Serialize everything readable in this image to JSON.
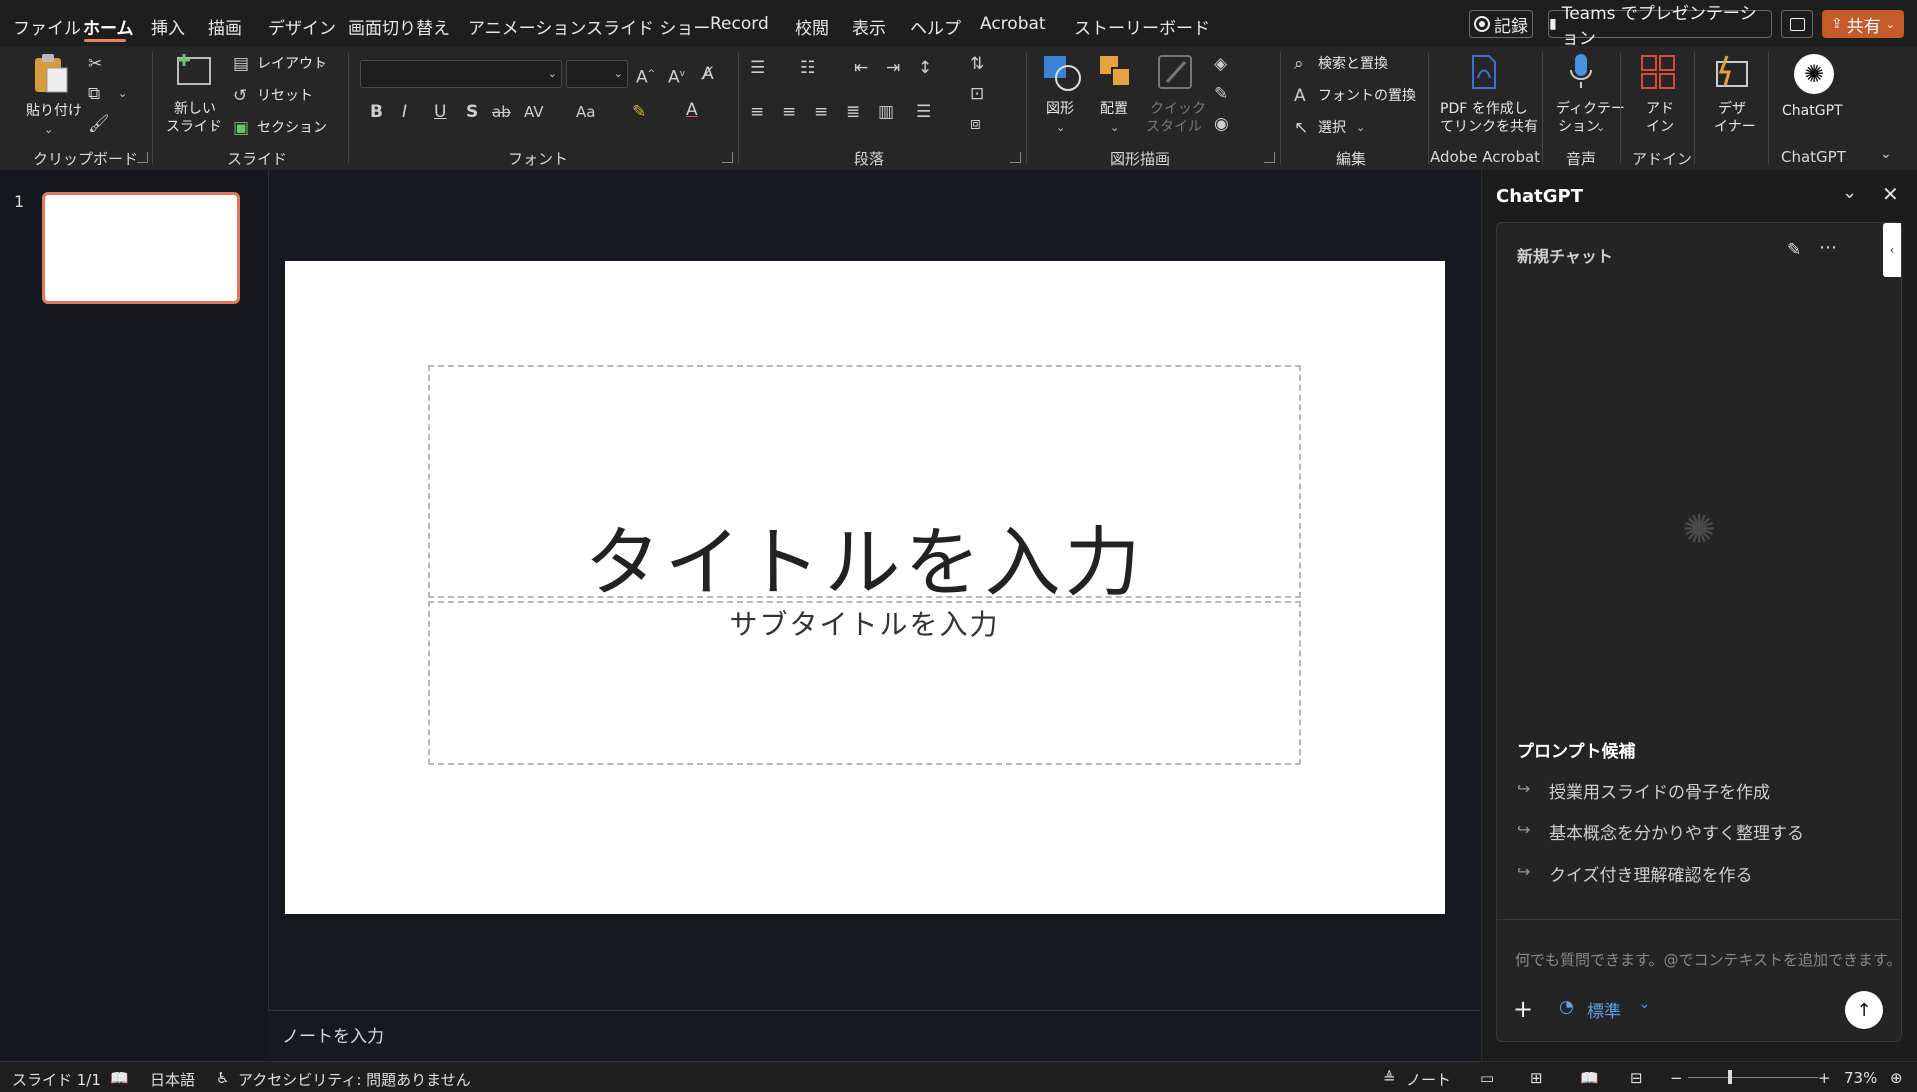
{
  "menu": {
    "tabs": [
      "ファイル",
      "ホーム",
      "挿入",
      "描画",
      "デザイン",
      "画面切り替え",
      "アニメーション",
      "スライド ショー",
      "Record",
      "校閲",
      "表示",
      "ヘルプ",
      "Acrobat",
      "ストーリーボード"
    ],
    "record_label": "記録",
    "teams_label": "Teams でプレゼンテーション",
    "share_label": "共有"
  },
  "ribbon": {
    "clipboard": {
      "paste": "貼り付け",
      "label": "クリップボード"
    },
    "slides": {
      "new_slide_1": "新しい",
      "new_slide_2": "スライド",
      "layout": "レイアウト",
      "reset": "リセット",
      "section": "セクション",
      "label": "スライド"
    },
    "font": {
      "label": "フォント",
      "bold": "B",
      "italic": "I",
      "underline": "U",
      "shadow": "S",
      "strike": "ab",
      "spacing": "AV",
      "case": "Aa",
      "color": "A"
    },
    "paragraph": {
      "label": "段落"
    },
    "drawing": {
      "shapes": "図形",
      "arrange": "配置",
      "quick_1": "クイック",
      "quick_2": "スタイル",
      "label": "図形描画"
    },
    "editing": {
      "find_replace": "検索と置換",
      "font_replace": "フォントの置換",
      "select": "選択",
      "label": "編集"
    },
    "acrobat": {
      "line1": "PDF を作成し",
      "line2": "てリンクを共有",
      "label": "Adobe Acrobat"
    },
    "voice": {
      "line1": "ディクテー",
      "line2": "ション",
      "label": "音声"
    },
    "addins": {
      "line1": "アド",
      "line2": "イン",
      "label": "アドイン"
    },
    "designer": {
      "line1": "デザ",
      "line2": "イナー"
    },
    "chatgpt": {
      "button": "ChatGPT",
      "label": "ChatGPT"
    }
  },
  "thumbs": {
    "slide_number": "1"
  },
  "slide": {
    "title": "タイトルを入力",
    "subtitle": "サブタイトルを入力"
  },
  "notes": {
    "placeholder": "ノートを入力"
  },
  "gpt": {
    "pane_title": "ChatGPT",
    "chat_title": "新規チャット",
    "prompts_heading": "プロンプト候補",
    "prompts": [
      "授業用スライドの骨子を作成",
      "基本概念を分かりやすく整理する",
      "クイズ付き理解確認を作る"
    ],
    "input_placeholder": "何でも質問できます。@でコンテキストを追加できます。",
    "mode": "標準"
  },
  "status": {
    "slide_count": "スライド 1/1",
    "language": "日本語",
    "accessibility": "アクセシビリティ: 問題ありません",
    "notes_btn": "ノート",
    "zoom": "73%"
  },
  "colors": {
    "accent": "#e8865a",
    "share": "#c55a2a",
    "link": "#5aa3e8"
  }
}
